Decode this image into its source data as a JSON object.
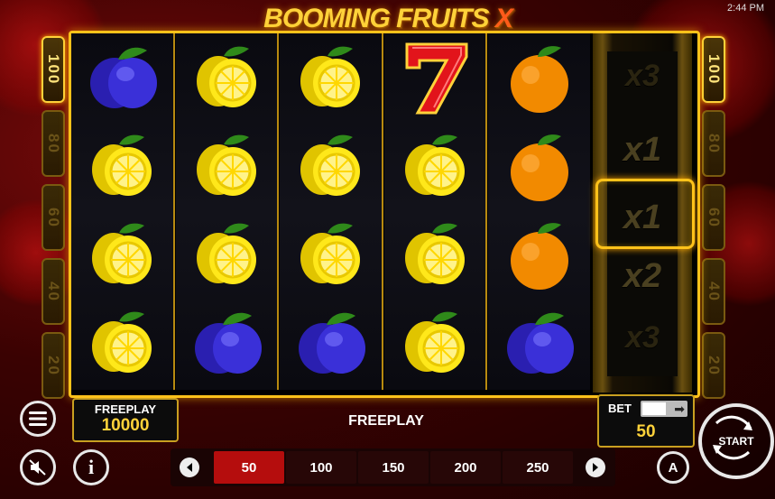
{
  "status": {
    "clock": "2:44 PM"
  },
  "game": {
    "title_main": "BOOMING FRUITS",
    "title_x": "X"
  },
  "ladders": {
    "left": [
      "100",
      "80",
      "60",
      "40",
      "20"
    ],
    "right": [
      "100",
      "80",
      "60",
      "40",
      "20"
    ],
    "active_index": 0
  },
  "reels": [
    [
      "plum",
      "lemon",
      "lemon",
      "lemon"
    ],
    [
      "lemon",
      "lemon",
      "lemon",
      "plum"
    ],
    [
      "lemon",
      "lemon",
      "lemon",
      "plum"
    ],
    [
      "seven",
      "lemon",
      "lemon",
      "lemon"
    ],
    [
      "orange",
      "orange",
      "orange",
      "plum"
    ]
  ],
  "multiplier_reel": {
    "values": [
      "x3",
      "x1",
      "x1",
      "x2",
      "x3"
    ],
    "selected_index": 2
  },
  "freeplay_panel": {
    "label": "FREEPLAY",
    "value": "10000"
  },
  "center_message": "FREEPLAY",
  "bet_panel": {
    "label": "BET",
    "value": "50",
    "toggle_arrow": "➡"
  },
  "bet_options": {
    "values": [
      "50",
      "100",
      "150",
      "200",
      "250"
    ],
    "selected_index": 0
  },
  "buttons": {
    "start_label": "START",
    "auto_label": "A",
    "info_label": "i"
  },
  "colors": {
    "frame_gold": "#ffc21a",
    "selected_bet": "#b50d0d",
    "value_yellow": "#ffd23a"
  }
}
